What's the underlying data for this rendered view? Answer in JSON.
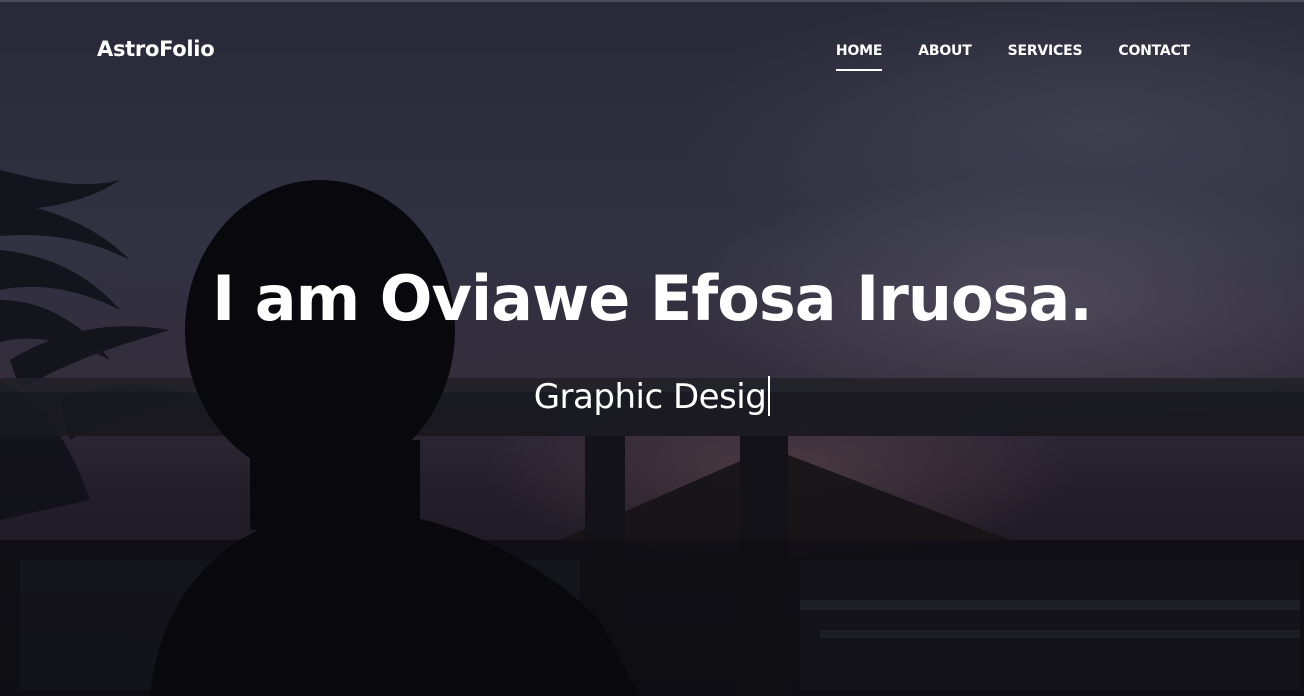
{
  "navbar": {
    "brand": "AstroFolio",
    "links": [
      {
        "label": "HOME",
        "active": true
      },
      {
        "label": "ABOUT",
        "active": false
      },
      {
        "label": "SERVICES",
        "active": false
      },
      {
        "label": "CONTACT",
        "active": false
      }
    ]
  },
  "hero": {
    "headline": "I am Oviawe Efosa Iruosa.",
    "typed_text": "Graphic Desig"
  }
}
